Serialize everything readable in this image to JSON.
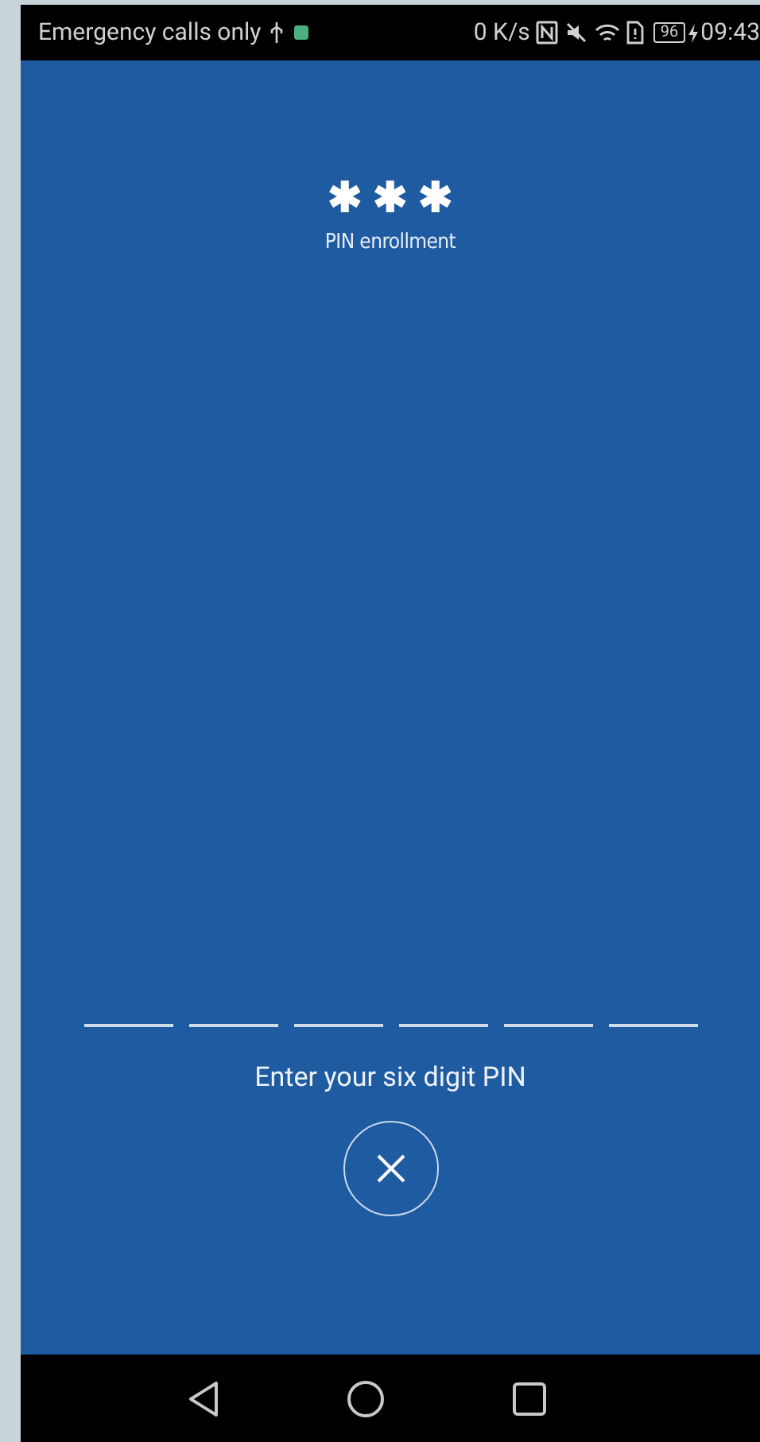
{
  "status_bar": {
    "carrier": "Emergency calls only",
    "speed": "0 K/s",
    "battery": "96",
    "time": "09:43"
  },
  "header": {
    "masked_pin": "✱ ✱ ✱",
    "title": "PIN enrollment"
  },
  "pin_slots": [
    {
      "filled": false
    },
    {
      "filled": false
    },
    {
      "filled": false
    },
    {
      "filled": false
    },
    {
      "filled": false
    },
    {
      "filled": false
    }
  ],
  "prompt": "Enter your six digit PIN",
  "cancel_button": {
    "kind": "close"
  }
}
